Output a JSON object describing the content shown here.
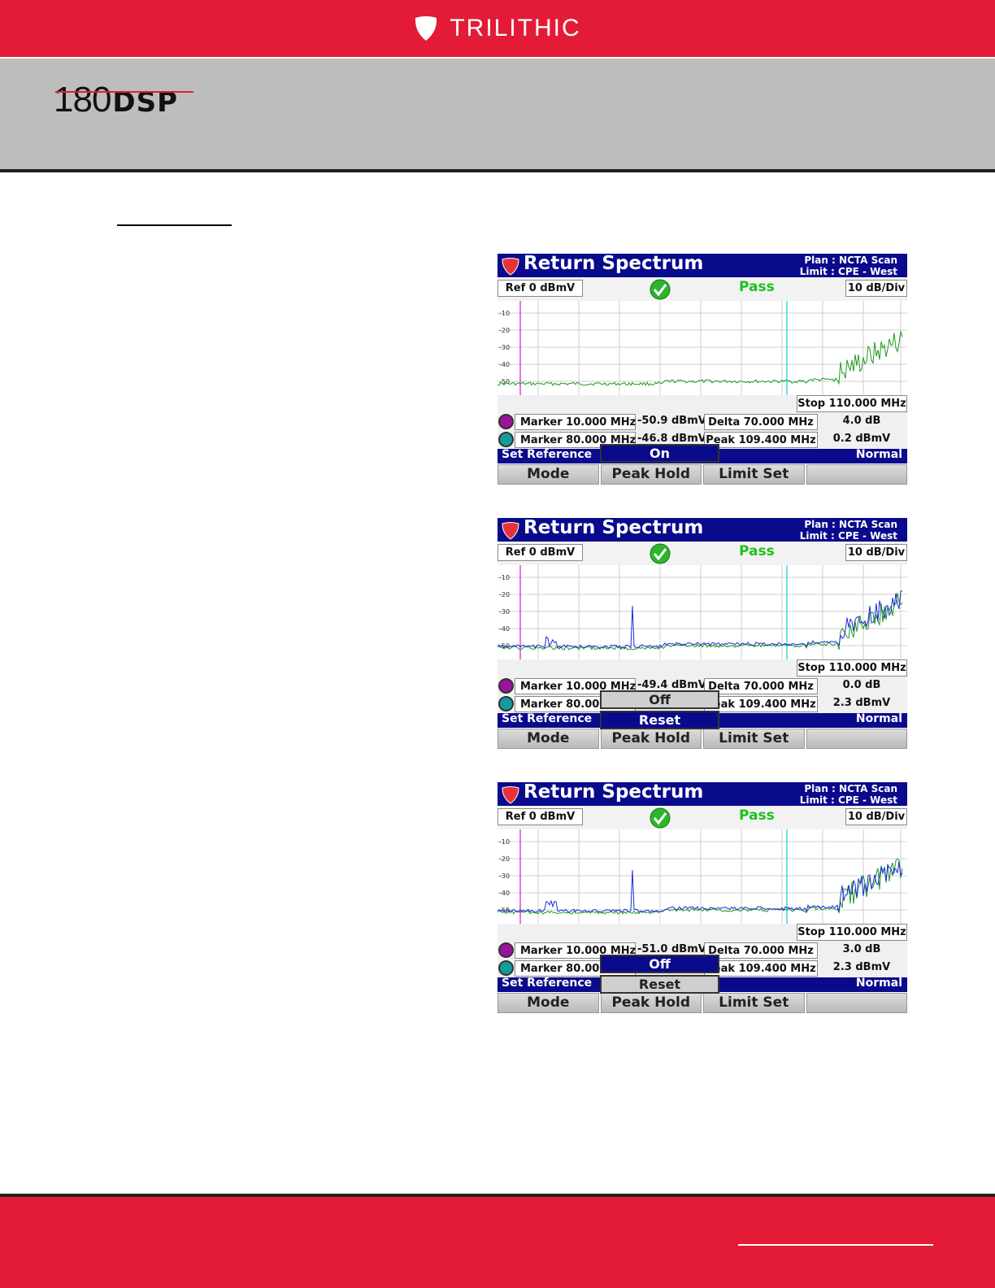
{
  "header": {
    "brand": "TRILITHIC",
    "product_num": "180",
    "product_suffix": "DSP"
  },
  "screens": [
    {
      "title": "Return Spectrum",
      "plan": "Plan : NCTA Scan",
      "limit": "Limit : CPE - West",
      "ref": "Ref 0 dBmV",
      "status": "Pass",
      "scale": "10 dB/Div",
      "y_ticks": [
        "-10",
        "-20",
        "-30",
        "-40",
        "-50"
      ],
      "stop": "Stop 110.000 MHz",
      "marker1": {
        "label": "Marker 10.000 MHz",
        "value": "-50.9 dBmV"
      },
      "marker2": {
        "label": "Marker 80.000 MHz",
        "value": "-46.8 dBmV"
      },
      "delta": {
        "label": "Delta 70.000 MHz",
        "value": "4.0 dB"
      },
      "peak": {
        "label": "Peak 109.400 MHz",
        "value": "0.2 dBmV"
      },
      "setref": "Set Reference",
      "mode_status": "Normal",
      "softkeys": [
        "Mode",
        "Peak Hold",
        "Limit Set",
        ""
      ],
      "popup": [
        {
          "label": "On",
          "selected": true
        }
      ],
      "traces": [
        "green"
      ]
    },
    {
      "title": "Return Spectrum",
      "plan": "Plan : NCTA Scan",
      "limit": "Limit : CPE - West",
      "ref": "Ref 0 dBmV",
      "status": "Pass",
      "scale": "10 dB/Div",
      "y_ticks": [
        "-10",
        "-20",
        "-30",
        "-40",
        "-50"
      ],
      "stop": "Stop 110.000 MHz",
      "marker1": {
        "label": "Marker 10.000 MHz",
        "value": "-49.4 dBmV"
      },
      "marker2": {
        "label": "Marker 80.000 MHz",
        "value": ""
      },
      "delta": {
        "label": "Delta 70.000 MHz",
        "value": "0.0 dB"
      },
      "peak": {
        "label": "Peak 109.400 MHz",
        "value": "2.3 dBmV"
      },
      "setref": "Set Reference",
      "mode_status": "Normal",
      "softkeys": [
        "Mode",
        "Peak Hold",
        "Limit Set",
        ""
      ],
      "popup": [
        {
          "label": "Off",
          "selected": false
        },
        {
          "label": "Reset",
          "selected": true
        }
      ],
      "traces": [
        "green",
        "blue"
      ]
    },
    {
      "title": "Return Spectrum",
      "plan": "Plan : NCTA Scan",
      "limit": "Limit : CPE - West",
      "ref": "Ref 0 dBmV",
      "status": "Pass",
      "scale": "10 dB/Div",
      "y_ticks": [
        "-10",
        "-20",
        "-30",
        "-40",
        "-50"
      ],
      "stop": "Stop 110.000 MHz",
      "marker1": {
        "label": "Marker 10.000 MHz",
        "value": "-51.0 dBmV"
      },
      "marker2": {
        "label": "Marker 80.000 MHz",
        "value": ""
      },
      "delta": {
        "label": "Delta 70.000 MHz",
        "value": "3.0 dB"
      },
      "peak": {
        "label": "Peak 109.400 MHz",
        "value": "2.3 dBmV"
      },
      "setref": "Set Reference",
      "mode_status": "Normal",
      "softkeys": [
        "Mode",
        "Peak Hold",
        "Limit Set",
        ""
      ],
      "popup": [
        {
          "label": "Off",
          "selected": true
        },
        {
          "label": "Reset",
          "selected": false
        }
      ],
      "traces": [
        "green",
        "blue"
      ]
    }
  ]
}
